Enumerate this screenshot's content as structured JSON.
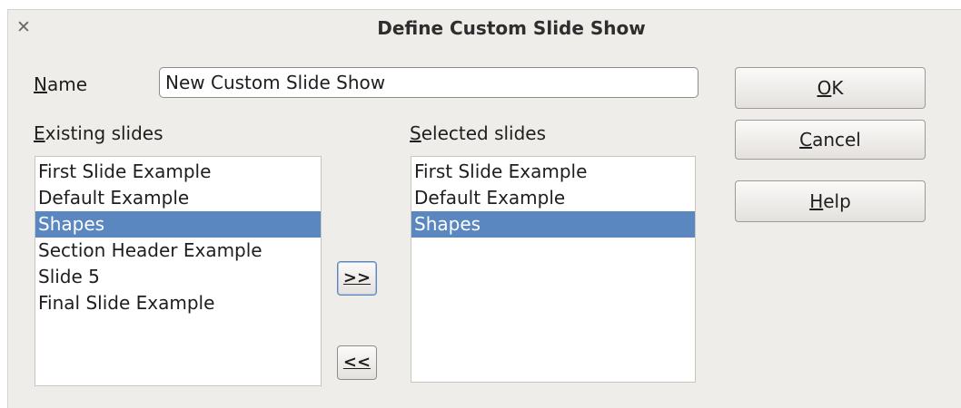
{
  "window": {
    "title": "Define Custom Slide Show",
    "close_glyph": "✕"
  },
  "name_field": {
    "label_accel": "N",
    "label_rest": "ame",
    "value": "New Custom Slide Show"
  },
  "existing": {
    "label_accel": "E",
    "label_rest": "xisting slides",
    "items": [
      {
        "label": "First Slide Example",
        "selected": false
      },
      {
        "label": "Default Example",
        "selected": false
      },
      {
        "label": "Shapes",
        "selected": true
      },
      {
        "label": "Section Header Example",
        "selected": false
      },
      {
        "label": "Slide 5",
        "selected": false
      },
      {
        "label": "Final Slide Example",
        "selected": false
      }
    ]
  },
  "selected": {
    "label_accel": "S",
    "label_rest": "elected slides",
    "items": [
      {
        "label": "First Slide Example",
        "selected": false
      },
      {
        "label": "Default Example",
        "selected": false
      },
      {
        "label": "Shapes",
        "selected": true
      }
    ]
  },
  "transfer": {
    "add_label": ">>",
    "remove_label": "<<"
  },
  "buttons": {
    "ok_accel": "O",
    "ok_rest": "K",
    "cancel_accel": "C",
    "cancel_rest": "ancel",
    "help_accel": "H",
    "help_rest": "elp"
  },
  "colors": {
    "selection": "#5a87bf",
    "dialog_bg": "#efedea"
  },
  "icons": {
    "close": "close-icon"
  }
}
